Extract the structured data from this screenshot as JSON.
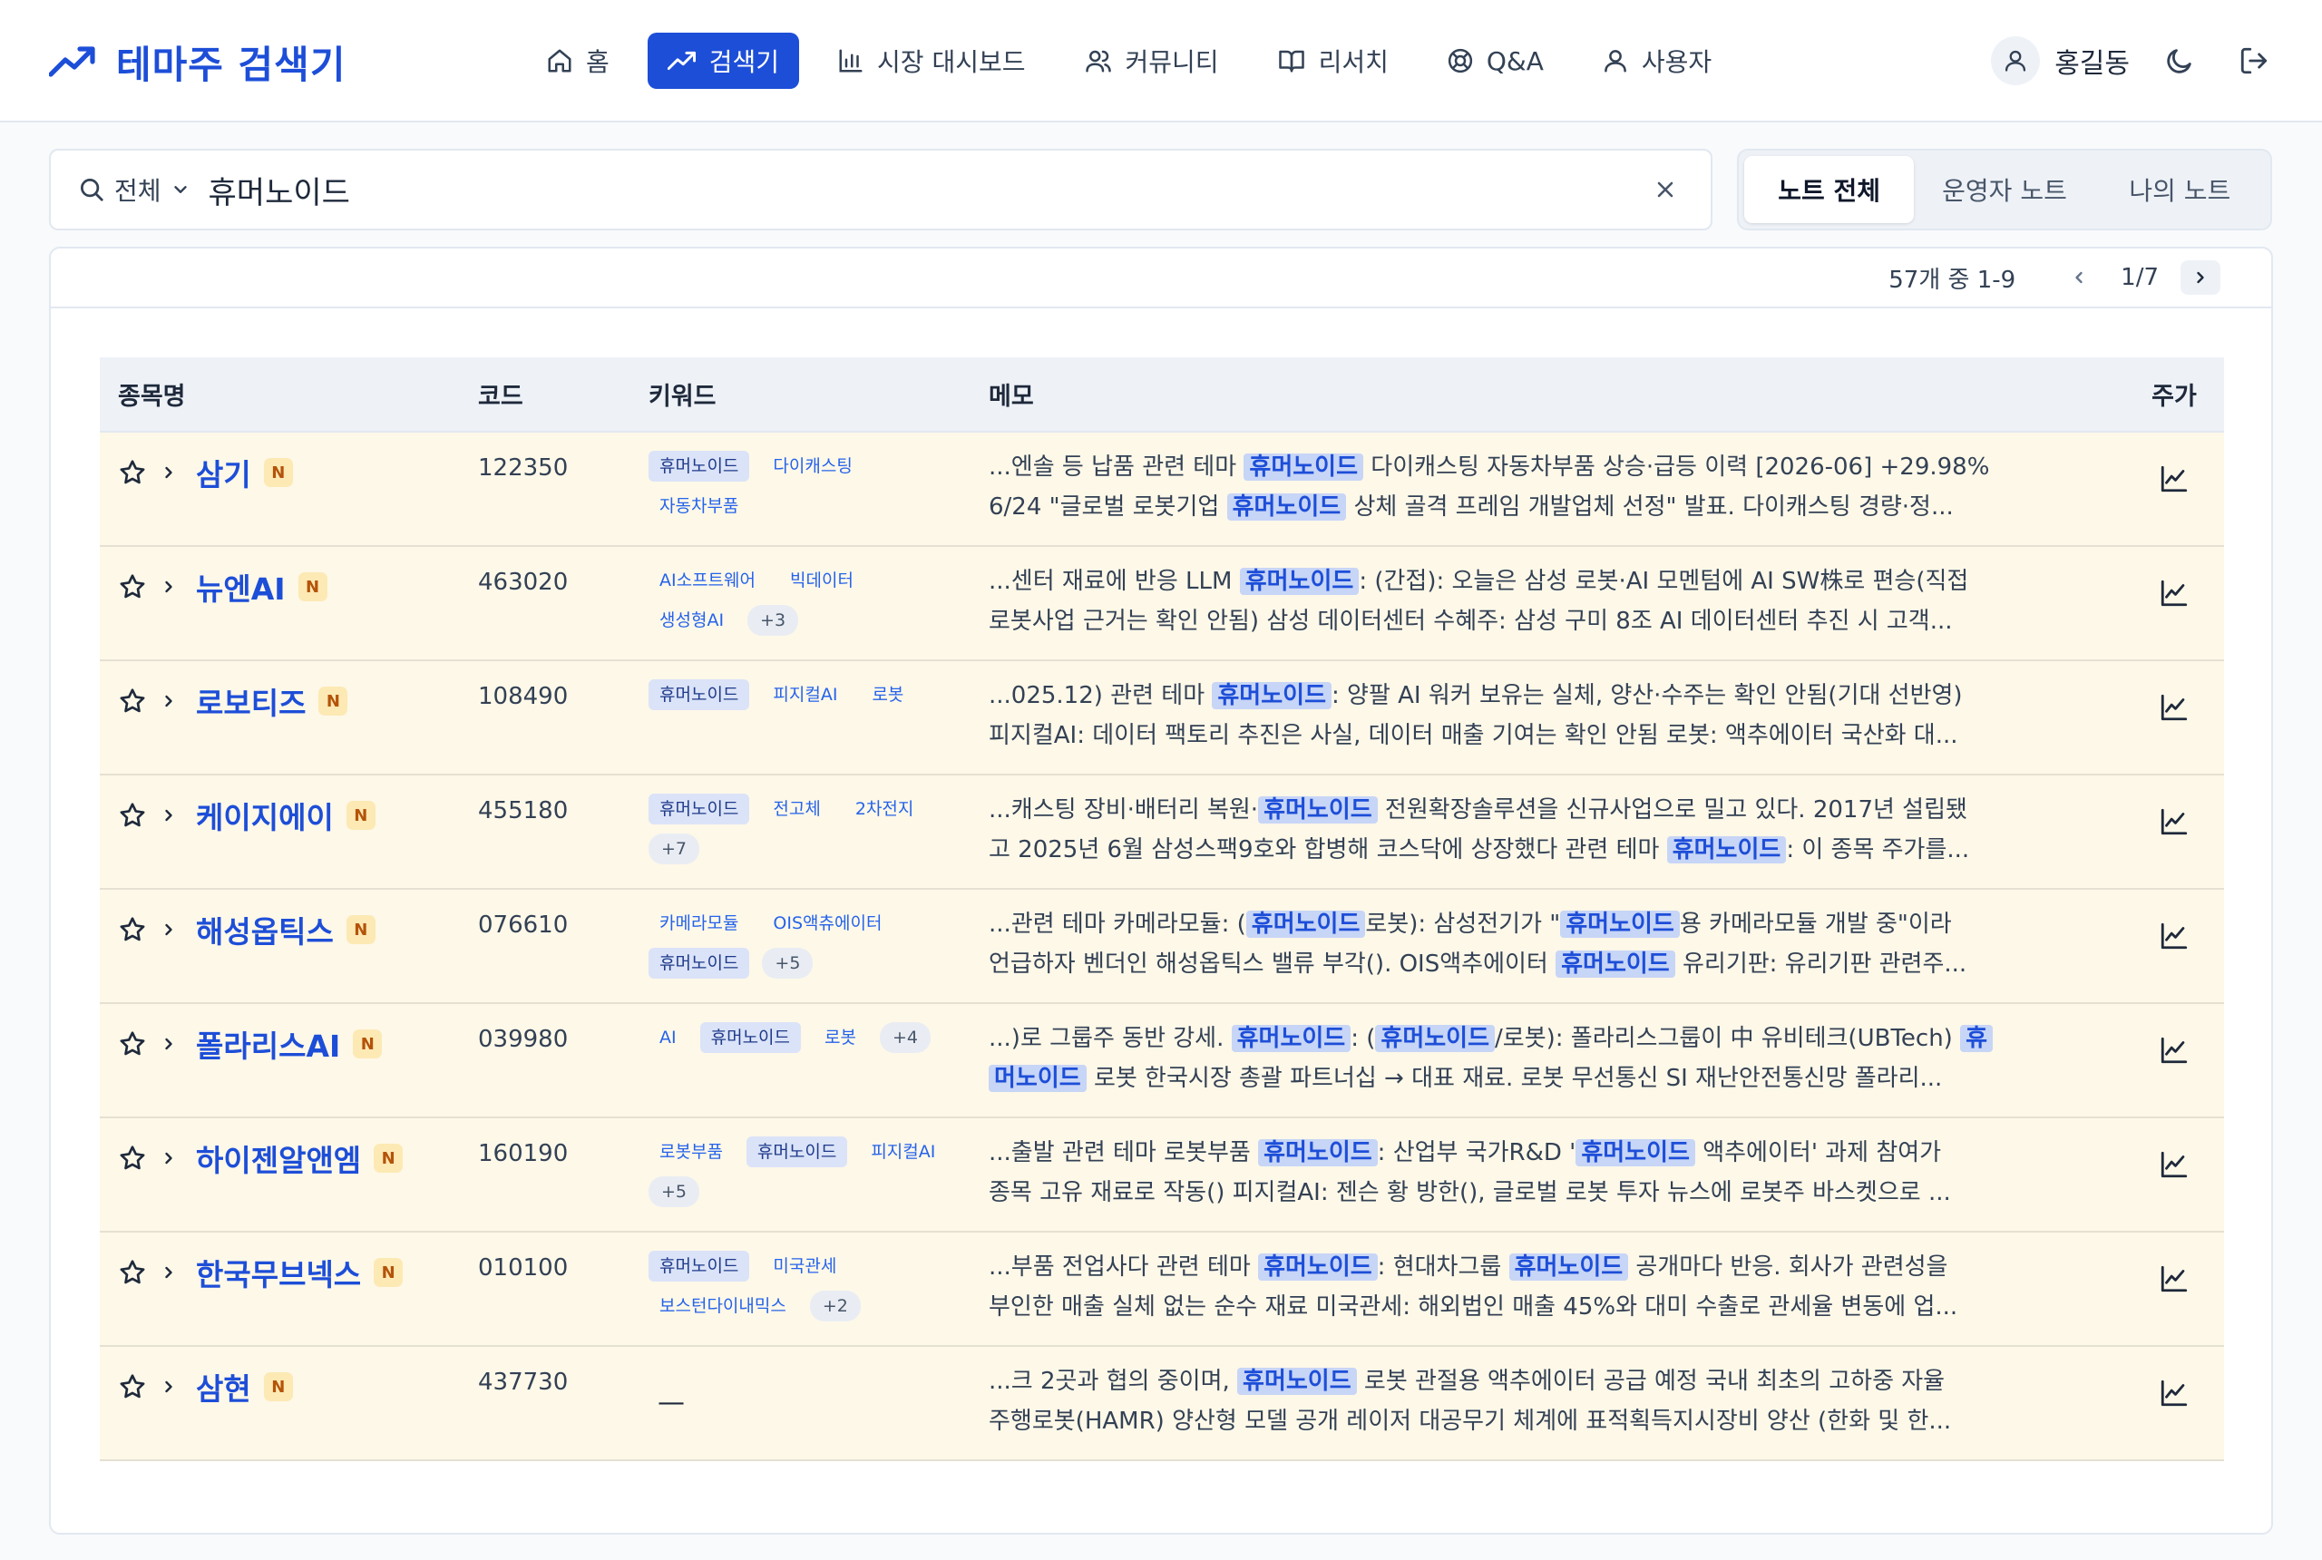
{
  "app": {
    "title": "테마주 검색기"
  },
  "nav": {
    "items": [
      {
        "label": "홈",
        "icon": "home-icon",
        "active": false
      },
      {
        "label": "검색기",
        "icon": "trending-up-icon",
        "active": true
      },
      {
        "label": "시장 대시보드",
        "icon": "bar-chart-icon",
        "active": false
      },
      {
        "label": "커뮤니티",
        "icon": "users-icon",
        "active": false
      },
      {
        "label": "리서치",
        "icon": "book-open-icon",
        "active": false
      },
      {
        "label": "Q&A",
        "icon": "lifebuoy-icon",
        "active": false
      },
      {
        "label": "사용자",
        "icon": "user-icon",
        "active": false
      }
    ]
  },
  "user": {
    "name": "홍길동"
  },
  "search": {
    "scope": "전체",
    "query": "휴머노이드"
  },
  "note_tabs": {
    "items": [
      {
        "label": "노트 전체",
        "active": true
      },
      {
        "label": "운영자 노트",
        "active": false
      },
      {
        "label": "나의 노트",
        "active": false
      }
    ]
  },
  "pagination": {
    "count_text": "57개 중 1-9",
    "page_text": "1/7"
  },
  "table": {
    "headers": {
      "name": "종목명",
      "code": "코드",
      "keywords": "키워드",
      "memo": "메모",
      "price": "주가"
    },
    "badge": "N",
    "empty_keyword": "—",
    "rows": [
      {
        "name": "삼기",
        "code": "122350",
        "keywords": [
          {
            "text": "휴머노이드",
            "hl": true
          },
          {
            "text": "다이캐스팅",
            "hl": false
          },
          {
            "text": "자동차부품",
            "hl": false
          }
        ],
        "more": "",
        "memo": [
          [
            {
              "t": "...엔솔 등 납품 관련 테마 "
            },
            {
              "t": "휴머노이드",
              "m": true
            },
            {
              "t": " 다이캐스팅 자동차부품 상승·급등 이력 [2026-06] +29.98%"
            }
          ],
          [
            {
              "t": "6/24 \"글로벌 로봇기업 "
            },
            {
              "t": "휴머노이드",
              "m": true
            },
            {
              "t": " 상체 골격 프레임 개발업체 선정\" 발표. 다이캐스팅 경량·정..."
            }
          ]
        ]
      },
      {
        "name": "뉴엔AI",
        "code": "463020",
        "keywords": [
          {
            "text": "AI소프트웨어",
            "hl": false
          },
          {
            "text": "빅데이터",
            "hl": false
          },
          {
            "text": "생성형AI",
            "hl": false
          }
        ],
        "more": "+3",
        "memo": [
          [
            {
              "t": "...센터 재료에 반응 LLM "
            },
            {
              "t": "휴머노이드",
              "m": true
            },
            {
              "t": ": (간접): 오늘은 삼성 로봇·AI 모멘텀에 AI SW株로 편승(직접"
            }
          ],
          [
            {
              "t": "로봇사업 근거는 확인 안됨) 삼성 데이터센터 수혜주: 삼성 구미 8조 AI 데이터센터 추진 시 고객..."
            }
          ]
        ]
      },
      {
        "name": "로보티즈",
        "code": "108490",
        "keywords": [
          {
            "text": "휴머노이드",
            "hl": true
          },
          {
            "text": "피지컬AI",
            "hl": false
          },
          {
            "text": "로봇",
            "hl": false
          }
        ],
        "more": "",
        "memo": [
          [
            {
              "t": "...025.12) 관련 테마 "
            },
            {
              "t": "휴머노이드",
              "m": true
            },
            {
              "t": ": 양팔 AI 워커 보유는 실체, 양산·수주는 확인 안됨(기대 선반영)"
            }
          ],
          [
            {
              "t": "피지컬AI: 데이터 팩토리 추진은 사실, 데이터 매출 기여는 확인 안됨 로봇: 액추에이터 국산화 대..."
            }
          ]
        ]
      },
      {
        "name": "케이지에이",
        "code": "455180",
        "keywords": [
          {
            "text": "휴머노이드",
            "hl": true
          },
          {
            "text": "전고체",
            "hl": false
          },
          {
            "text": "2차전지",
            "hl": false
          }
        ],
        "more": "+7",
        "memo": [
          [
            {
              "t": "...캐스팅 장비·배터리 복원·"
            },
            {
              "t": "휴머노이드",
              "m": true
            },
            {
              "t": " 전원확장솔루션을 신규사업으로 밀고 있다. 2017년 설립됐"
            }
          ],
          [
            {
              "t": "고 2025년 6월 삼성스팩9호와 합병해 코스닥에 상장했다 관련 테마 "
            },
            {
              "t": "휴머노이드",
              "m": true
            },
            {
              "t": ": 이 종목 주가를..."
            }
          ]
        ]
      },
      {
        "name": "해성옵틱스",
        "code": "076610",
        "keywords": [
          {
            "text": "카메라모듈",
            "hl": false
          },
          {
            "text": "OIS액츄에이터",
            "hl": false
          },
          {
            "text": "휴머노이드",
            "hl": true
          }
        ],
        "more": "+5",
        "memo": [
          [
            {
              "t": "...관련 테마 카메라모듈: ("
            },
            {
              "t": "휴머노이드",
              "m": true
            },
            {
              "t": "로봇): 삼성전기가 \""
            },
            {
              "t": "휴머노이드",
              "m": true
            },
            {
              "t": "용 카메라모듈 개발 중\"이라"
            }
          ],
          [
            {
              "t": "언급하자 벤더인 해성옵틱스 밸류 부각(). OIS액추에이터 "
            },
            {
              "t": "휴머노이드",
              "m": true
            },
            {
              "t": " 유리기판: 유리기판 관련주..."
            }
          ]
        ]
      },
      {
        "name": "폴라리스AI",
        "code": "039980",
        "keywords": [
          {
            "text": "AI",
            "hl": false
          },
          {
            "text": "휴머노이드",
            "hl": true
          },
          {
            "text": "로봇",
            "hl": false
          }
        ],
        "more": "+4",
        "memo": [
          [
            {
              "t": "...)로 그룹주 동반 강세. "
            },
            {
              "t": "휴머노이드",
              "m": true
            },
            {
              "t": ": ("
            },
            {
              "t": "휴머노이드",
              "m": true
            },
            {
              "t": "/로봇): 폴라리스그룹이 中 유비테크(UBTech) "
            },
            {
              "t": "휴",
              "m": true
            }
          ],
          [
            {
              "t": "머노이드",
              "m": true
            },
            {
              "t": " 로봇 한국시장 총괄 파트너십 → 대표 재료. 로봇 무선통신 SI 재난안전통신망 폴라리..."
            }
          ]
        ]
      },
      {
        "name": "하이젠알앤엠",
        "code": "160190",
        "keywords": [
          {
            "text": "로봇부품",
            "hl": false
          },
          {
            "text": "휴머노이드",
            "hl": true
          },
          {
            "text": "피지컬AI",
            "hl": false
          }
        ],
        "more": "+5",
        "memo": [
          [
            {
              "t": "...출발 관련 테마 로봇부품 "
            },
            {
              "t": "휴머노이드",
              "m": true
            },
            {
              "t": ": 산업부 국가R&D '"
            },
            {
              "t": "휴머노이드",
              "m": true
            },
            {
              "t": " 액추에이터' 과제 참여가"
            }
          ],
          [
            {
              "t": "종목 고유 재료로 작동() 피지컬AI: 젠슨 황 방한(), 글로벌 로봇 투자 뉴스에 로봇주 바스켓으로 ..."
            }
          ]
        ]
      },
      {
        "name": "한국무브넥스",
        "code": "010100",
        "keywords": [
          {
            "text": "휴머노이드",
            "hl": true
          },
          {
            "text": "미국관세",
            "hl": false
          },
          {
            "text": "보스턴다이내믹스",
            "hl": false
          }
        ],
        "more": "+2",
        "memo": [
          [
            {
              "t": "...부품 전업사다 관련 테마 "
            },
            {
              "t": "휴머노이드",
              "m": true
            },
            {
              "t": ": 현대차그룹 "
            },
            {
              "t": "휴머노이드",
              "m": true
            },
            {
              "t": " 공개마다 반응. 회사가 관련성을"
            }
          ],
          [
            {
              "t": "부인한 매출 실체 없는 순수 재료 미국관세: 해외법인 매출 45%와 대미 수출로 관세율 변동에 업..."
            }
          ]
        ]
      },
      {
        "name": "삼현",
        "code": "437730",
        "keywords": [],
        "more": "",
        "memo": [
          [
            {
              "t": "...크 2곳과 협의 중이며, "
            },
            {
              "t": "휴머노이드",
              "m": true
            },
            {
              "t": " 로봇 관절용 액추에이터 공급 예정 국내 최초의 고하중 자율"
            }
          ],
          [
            {
              "t": "주행로봇(HAMR) 양산형 모델 공개 레이저 대공무기 체계에 표적획득지시장비 양산 (한화 및 한..."
            }
          ]
        ]
      }
    ]
  },
  "colors": {
    "primary": "#1d4ed8",
    "row_bg": "#fef8e8",
    "highlight_bg": "#c7d5f6",
    "badge_bg": "#fde9b4"
  }
}
